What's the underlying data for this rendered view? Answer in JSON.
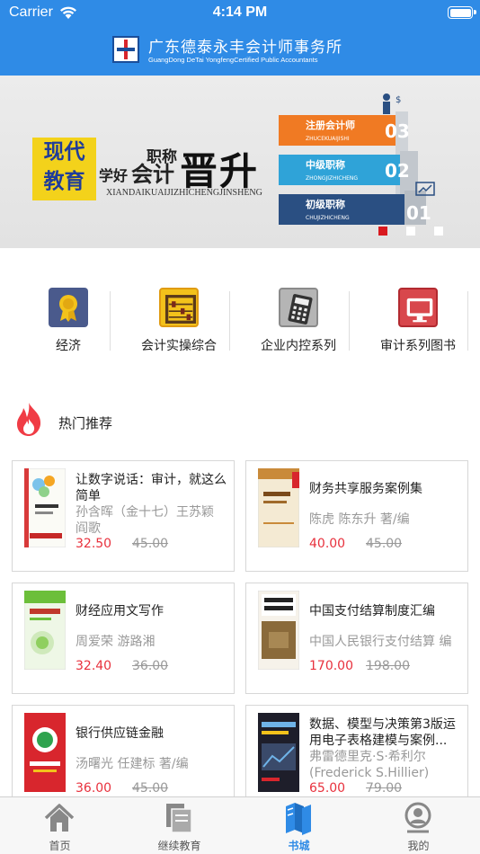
{
  "status_bar": {
    "carrier": "Carrier",
    "time": "4:14 PM"
  },
  "header": {
    "title_cn": "广东德泰永丰会计师事务所",
    "title_en": "GuangDong DeTai YongfengCertified Public Accountants"
  },
  "banner": {
    "badge_lines": [
      "现代",
      "教育"
    ],
    "text_zhicheng": "职称",
    "text_xuehao": "学好",
    "text_kuaiji": "会计",
    "text_jinsheng": "晋升",
    "pinyin": "XIANDAIKUAIJIZHICHENGJINSHENG",
    "steps": [
      {
        "label": "注册会计师",
        "pinyin": "ZHUCEKUAIJISHI",
        "num": "03"
      },
      {
        "label": "中级职称",
        "pinyin": "ZHONGJIZHICHENG",
        "num": "02"
      },
      {
        "label": "初级职称",
        "pinyin": "CHUJIZHICHENG",
        "num": "01"
      }
    ],
    "slide_count": 3,
    "active_slide": 1
  },
  "categories": [
    {
      "label": "经济",
      "icon": "award-ribbon-icon",
      "bg": "#4a5a8c"
    },
    {
      "label": "会计实操综合",
      "icon": "abacus-icon",
      "bg": "#f3c21b"
    },
    {
      "label": "企业内控系列",
      "icon": "calculator-icon",
      "bg": "#9a9a9a"
    },
    {
      "label": "审计系列图书",
      "icon": "monitor-icon",
      "bg": "#d8474c"
    }
  ],
  "hot_section": {
    "title": "热门推荐",
    "icon": "fire-icon",
    "accent": "#e8313d"
  },
  "books": [
    {
      "title": "让数字说话：审计，就这么简单",
      "author": "孙含晖（金十七）王苏颖 阎歌",
      "price": "32.50",
      "original_price": "45.00"
    },
    {
      "title": "财务共享服务案例集",
      "author": "陈虎 陈东升 著/编",
      "price": "40.00",
      "original_price": "45.00"
    },
    {
      "title": "财经应用文写作",
      "author": "周爱荣 游路湘",
      "price": "32.40",
      "original_price": "36.00"
    },
    {
      "title": "中国支付结算制度汇编",
      "author": "中国人民银行支付结算 编",
      "price": "170.00",
      "original_price": "198.00"
    },
    {
      "title": "银行供应链金融",
      "author": "汤曙光 任建标 著/编",
      "price": "36.00",
      "original_price": "45.00"
    },
    {
      "title": "数据、模型与决策第3版运用电子表格建模与案例...",
      "author": "弗雷德里克·S·希利尔(Frederick S.Hillier)",
      "price": "65.00",
      "original_price": "79.00"
    }
  ],
  "tabs": [
    {
      "label": "首页",
      "icon": "home-icon"
    },
    {
      "label": "继续教育",
      "icon": "documents-icon"
    },
    {
      "label": "书城",
      "icon": "books-icon"
    },
    {
      "label": "我的",
      "icon": "user-icon"
    }
  ],
  "active_tab": 2,
  "colors": {
    "primary": "#2f8be6",
    "price_red": "#e8313d",
    "muted": "#999999"
  }
}
